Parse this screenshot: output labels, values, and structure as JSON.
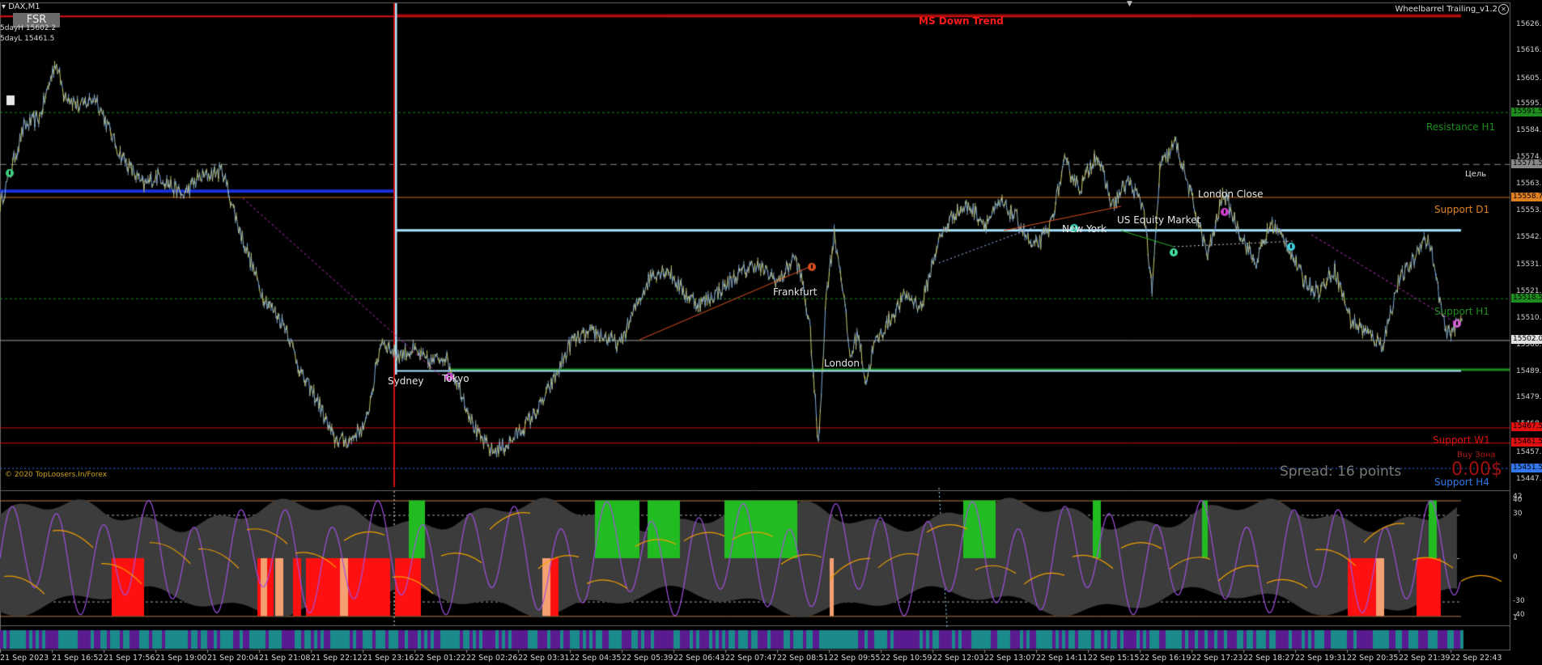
{
  "header": {
    "symbol": "DAX,M1",
    "five_day_high": "5dayH 15602.2",
    "five_day_low": "5dayL 15461.5",
    "fsr_button": "FSR",
    "indicator_name": "Wheelbarrel Trailing_v1.2",
    "copyright": "© 2020 TopLoosers.In/Forex"
  },
  "colors": {
    "background": "#000000",
    "support_res_red": "#d01010",
    "resistance_green": "#1e8c1e",
    "support_d1_orange": "#e08020",
    "support_h4_blue": "#3377ee",
    "light_blue_level": "#a8e4ff",
    "oscillator_green": "#22bb22",
    "oscillator_red": "#ff1010",
    "oscillator_peach": "#f4a070",
    "oscillator_purple": "#a050e0",
    "oscillator_orange": "#f0a000",
    "strip_teal": "#1a8a8a",
    "strip_purple": "#5a1a90"
  },
  "chart_data": {
    "type": "line",
    "symbol": "DAX",
    "timeframe": "M1",
    "price_axis_ticks": [
      15626.5,
      15616.0,
      15605.0,
      15595.0,
      15584.5,
      15574.0,
      15563.5,
      15553.0,
      15542.5,
      15531.5,
      15521.0,
      15510.5,
      15500.0,
      15489.5,
      15479.0,
      15468.5,
      15457.5,
      15447.0
    ],
    "time_axis_labels": [
      "21 Sep 2023",
      "21 Sep 16:52",
      "21 Sep 17:56",
      "21 Sep 19:00",
      "21 Sep 20:04",
      "21 Sep 21:08",
      "21 Sep 22:12",
      "21 Sep 23:16",
      "22 Sep 01:22",
      "22 Sep 02:26",
      "22 Sep 03:31",
      "22 Sep 04:35",
      "22 Sep 05:39",
      "22 Sep 06:43",
      "22 Sep 07:47",
      "22 Sep 08:51",
      "22 Sep 09:55",
      "22 Sep 10:59",
      "22 Sep 12:03",
      "22 Sep 13:07",
      "22 Sep 14:11",
      "22 Sep 15:15",
      "22 Sep 16:19",
      "22 Sep 17:23",
      "22 Sep 18:27",
      "22 Sep 19:31",
      "22 Sep 20:35",
      "22 Sep 21:39",
      "22 Sep 22:43"
    ],
    "price_series_anchors": [
      [
        0,
        15555
      ],
      [
        3,
        15586
      ],
      [
        5,
        15590
      ],
      [
        7,
        15612
      ],
      [
        8,
        15600
      ],
      [
        10,
        15594
      ],
      [
        12,
        15598
      ],
      [
        15,
        15576
      ],
      [
        18,
        15563
      ],
      [
        20,
        15567
      ],
      [
        23,
        15559
      ],
      [
        25,
        15566
      ],
      [
        28,
        15569
      ],
      [
        30,
        15547
      ],
      [
        33,
        15520
      ],
      [
        36,
        15507
      ],
      [
        38,
        15488
      ],
      [
        40,
        15478
      ],
      [
        42,
        15463
      ],
      [
        44,
        15462
      ],
      [
        45,
        15466
      ],
      [
        46,
        15468
      ],
      [
        48,
        15502
      ],
      [
        50,
        15496
      ],
      [
        52,
        15498
      ],
      [
        54,
        15493
      ],
      [
        56,
        15496
      ],
      [
        58,
        15482
      ],
      [
        60,
        15465
      ],
      [
        62,
        15458
      ],
      [
        64,
        15461
      ],
      [
        66,
        15468
      ],
      [
        68,
        15476
      ],
      [
        70,
        15488
      ],
      [
        72,
        15502
      ],
      [
        75,
        15505
      ],
      [
        78,
        15500
      ],
      [
        80,
        15515
      ],
      [
        82,
        15528
      ],
      [
        84,
        15530
      ],
      [
        86,
        15521
      ],
      [
        88,
        15516
      ],
      [
        90,
        15520
      ],
      [
        93,
        15528
      ],
      [
        95,
        15532
      ],
      [
        98,
        15525
      ],
      [
        100,
        15535
      ],
      [
        101,
        15525
      ],
      [
        102,
        15505
      ],
      [
        103,
        15460
      ],
      [
        104,
        15520
      ],
      [
        105,
        15544
      ],
      [
        106,
        15525
      ],
      [
        107,
        15495
      ],
      [
        108,
        15505
      ],
      [
        109,
        15485
      ],
      [
        110,
        15500
      ],
      [
        112,
        15510
      ],
      [
        114,
        15520
      ],
      [
        116,
        15515
      ],
      [
        118,
        15540
      ],
      [
        120,
        15552
      ],
      [
        122,
        15555
      ],
      [
        124,
        15548
      ],
      [
        126,
        15556
      ],
      [
        128,
        15550
      ],
      [
        130,
        15538
      ],
      [
        132,
        15545
      ],
      [
        134,
        15572
      ],
      [
        136,
        15562
      ],
      [
        138,
        15576
      ],
      [
        140,
        15555
      ],
      [
        142,
        15565
      ],
      [
        144,
        15554
      ],
      [
        145,
        15520
      ],
      [
        146,
        15570
      ],
      [
        148,
        15580
      ],
      [
        150,
        15558
      ],
      [
        152,
        15535
      ],
      [
        154,
        15560
      ],
      [
        156,
        15545
      ],
      [
        158,
        15532
      ],
      [
        160,
        15548
      ],
      [
        162,
        15540
      ],
      [
        164,
        15526
      ],
      [
        166,
        15521
      ],
      [
        168,
        15530
      ],
      [
        170,
        15510
      ],
      [
        172,
        15505
      ],
      [
        174,
        15500
      ],
      [
        176,
        15525
      ],
      [
        178,
        15534
      ],
      [
        179,
        15542
      ],
      [
        180,
        15540
      ],
      [
        182,
        15504
      ],
      [
        184,
        15510
      ]
    ],
    "horizontal_levels": [
      {
        "label": "MS Down Trend",
        "price": 15630.0,
        "color": "#d01010"
      },
      {
        "label": "Resistance H1",
        "price": 15592.0,
        "value_tag": "15591.5",
        "color": "#1e8c1e"
      },
      {
        "label": "Цель",
        "price": 15571.5,
        "value_tag": "15571.5",
        "color": "#888888"
      },
      {
        "label": "Support D1",
        "price": 15558.5,
        "value_tag": "15558.7",
        "color": "#e08020"
      },
      {
        "label": "",
        "price": 15545.5,
        "color": "#a8e4ff"
      },
      {
        "label": "Support H1",
        "price": 15518.5,
        "value_tag": "15518.5",
        "color": "#1e8c1e"
      },
      {
        "label": "",
        "price": 15502.0,
        "value_tag": "15502.0",
        "color": "#d0d0d0"
      },
      {
        "label": "",
        "price": 15490.5,
        "color": "#1e8c1e"
      },
      {
        "label": "Support W1",
        "price": 15467.5,
        "value_tag": "15467.5",
        "color": "#d01010"
      },
      {
        "label": "",
        "price": 15461.5,
        "value_tag": "15461.5",
        "color": "#d01010"
      },
      {
        "label": "Support H4",
        "price": 15451.5,
        "value_tag": "15451.5",
        "color": "#3377ee"
      }
    ],
    "session_labels": [
      "Sydney",
      "Tokyo",
      "London",
      "Frankfurt",
      "New York",
      "US Equity Market",
      "London Close"
    ],
    "overlay_text": {
      "buy_zone": "Buy Зона",
      "pnl": "0.00$",
      "spread": "Spread: 16 points"
    },
    "oscillator": {
      "ticks": [
        "42",
        "40",
        "30",
        "0",
        "-30",
        "-40",
        "1"
      ],
      "range": [
        -42,
        42
      ]
    }
  }
}
